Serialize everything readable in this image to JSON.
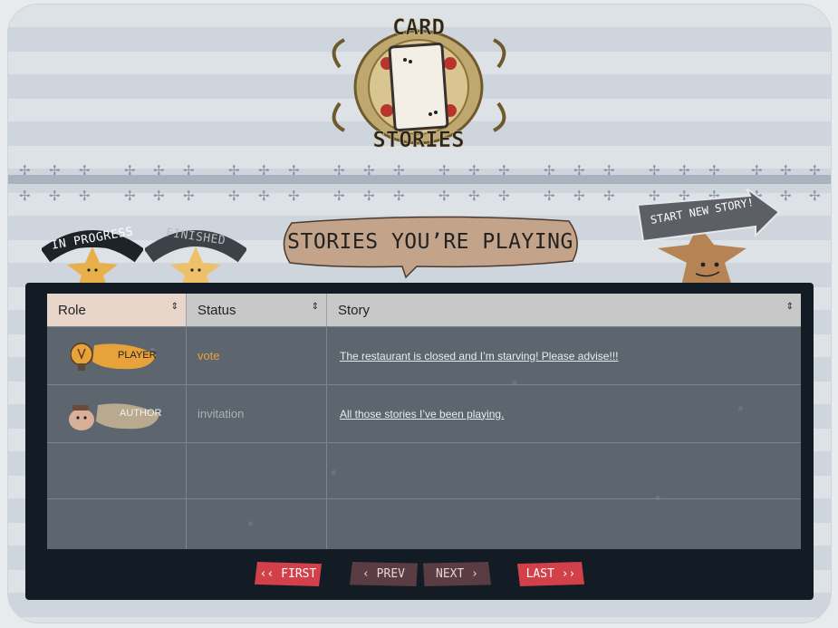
{
  "logo": {
    "line1": "CARD",
    "line2": "STORIES"
  },
  "tabs": [
    {
      "label": "IN PROGRESS",
      "state": "active",
      "color": "#1d2329"
    },
    {
      "label": "FINISHED",
      "state": "inactive",
      "color": "#3d4248"
    }
  ],
  "title": "STORIES YOU’RE PLAYING",
  "start_button": {
    "label": "START NEW STORY!"
  },
  "table": {
    "columns": [
      {
        "label": "Role",
        "sort": "⇕"
      },
      {
        "label": "Status",
        "sort": "⇕"
      },
      {
        "label": "Story",
        "sort": "⇕"
      }
    ],
    "rows": [
      {
        "role": "PLAYER",
        "status": "vote",
        "status_color": "#e8a23a",
        "story": "The restaurant is closed and I’m starving! Please advise!!!"
      },
      {
        "role": "AUTHOR",
        "status": "invitation",
        "status_color": "#a9b0b6",
        "story": "All those stories I’ve been playing."
      },
      {
        "role": "",
        "status": "",
        "story": ""
      },
      {
        "role": "",
        "status": "",
        "story": ""
      }
    ]
  },
  "pager": {
    "first": "‹‹ FIRST",
    "prev": "‹ PREV",
    "next": "NEXT ›",
    "last": "LAST ››"
  },
  "colors": {
    "accent_red": "#d2404a",
    "dark_maroon": "#5a3c44",
    "bubble_tan": "#c3a48a",
    "player_orange": "#e8a23a",
    "author_tan": "#b8a98f"
  }
}
